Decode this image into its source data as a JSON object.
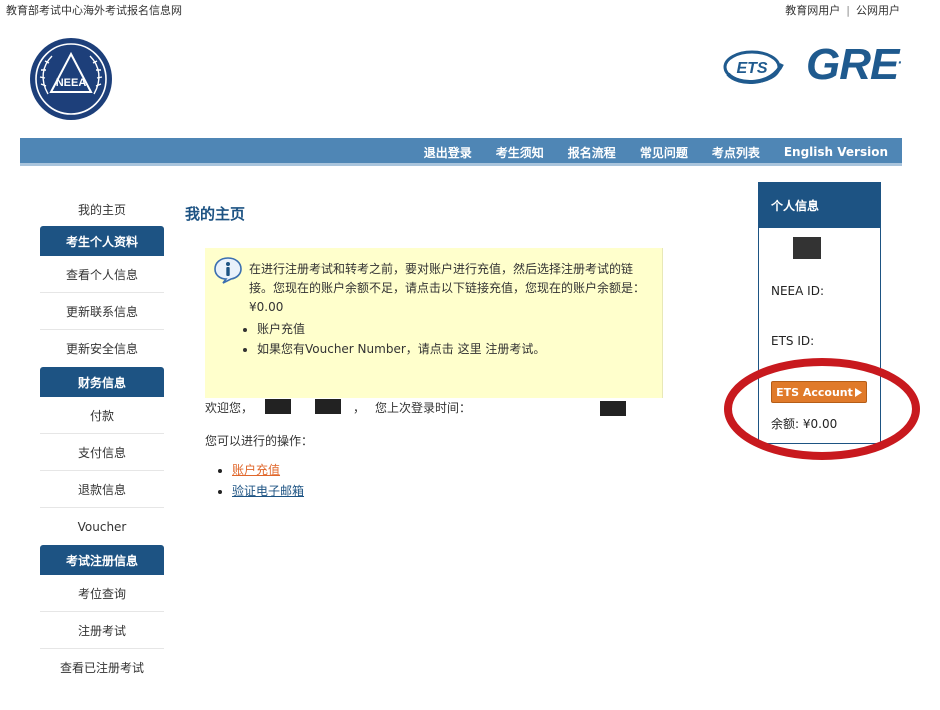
{
  "header": {
    "site_name": "教育部考试中心海外考试报名信息网",
    "top_links": [
      "教育网用户",
      "公网用户"
    ],
    "neea_logo_text": "NEEA",
    "ets_logo_text": "ETS",
    "gre_logo_text": "GRE"
  },
  "nav": {
    "items": [
      "退出登录",
      "考生须知",
      "报名流程",
      "常见问题",
      "考点列表",
      "English Version"
    ]
  },
  "sidebar": {
    "home": "我的主页",
    "sections": [
      {
        "header": "考生个人资料",
        "items": [
          "查看个人信息",
          "更新联系信息",
          "更新安全信息"
        ]
      },
      {
        "header": "财务信息",
        "items": [
          "付款",
          "支付信息",
          "退款信息",
          "Voucher"
        ]
      },
      {
        "header": "考试注册信息",
        "items": [
          "考位查询",
          "注册考试",
          "查看已注册考试"
        ]
      }
    ]
  },
  "main": {
    "title": "我的主页",
    "notice": {
      "text": "在进行注册考试和转考之前，要对账户进行充值，然后选择注册考试的链接。您现在的账户余额不足，请点击以下链接充值，您现在的账户余额是：¥0.00",
      "bullets": [
        "账户充值",
        "如果您有Voucher Number，请点击 这里 注册考试。"
      ]
    },
    "welcome_prefix": "欢迎您，",
    "welcome_comma": "，",
    "last_login_label": "您上次登录时间：",
    "ops_label": "您可以进行的操作：",
    "ops": [
      "账户充值",
      "验证电子邮箱"
    ]
  },
  "profile": {
    "header": "个人信息",
    "neea_id_label": "NEEA ID:",
    "ets_id_label": "ETS ID:",
    "ets_button": "ETS Account",
    "balance": "余额: ¥0.00"
  },
  "colors": {
    "nav_bar": "#4f86b5",
    "brand_dark_blue": "#1d5383",
    "notice_bg": "#ffffcc",
    "ets_button": "#e07a2a",
    "highlight_oval": "#c8191e",
    "link_orange": "#e0672b"
  },
  "icons": {
    "info": "info-icon",
    "ets_button_arrow": "play-triangle-icon"
  }
}
